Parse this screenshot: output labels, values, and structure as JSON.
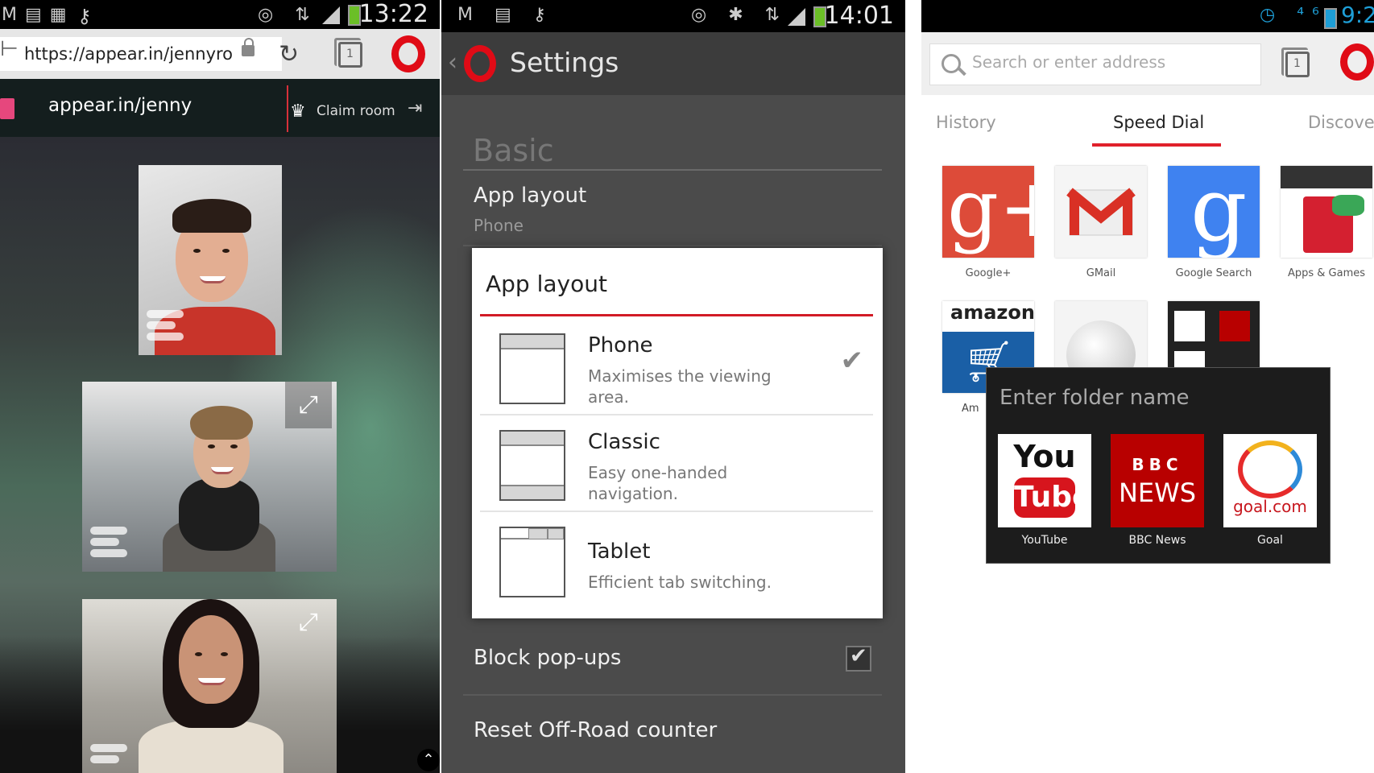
{
  "panel1": {
    "status_time": "13:22",
    "url": "https://appear.in/jennyro",
    "room_name": "appear.in/jenny",
    "claim_room": "Claim room"
  },
  "panel2": {
    "status_time": "14:01",
    "title": "Settings",
    "section": "Basic",
    "app_layout_label": "App layout",
    "app_layout_value": "Phone",
    "dialog": {
      "title": "App layout",
      "options": [
        {
          "name": "Phone",
          "desc": "Maximises the viewing area.",
          "selected": true
        },
        {
          "name": "Classic",
          "desc": "Easy one-handed navigation.",
          "selected": false
        },
        {
          "name": "Tablet",
          "desc": "Efficient tab switching.",
          "selected": false
        }
      ]
    },
    "block_popups": "Block pop-ups",
    "reset_offroad": "Reset Off-Road counter"
  },
  "panel3": {
    "status_time": "9:2",
    "search_placeholder": "Search or enter address",
    "tabs": [
      "History",
      "Speed Dial",
      "Discove"
    ],
    "speed_dials": [
      {
        "label": "Google+",
        "color": "#dd4b39"
      },
      {
        "label": "GMail",
        "color": "#f5f5f5"
      },
      {
        "label": "Google Search",
        "color": "#3f82f0"
      },
      {
        "label": "Apps & Games",
        "color": "#ffffff"
      }
    ],
    "second_row_label": "Am",
    "amazon_text": "amazon",
    "folder": {
      "title": "Enter folder name",
      "items": [
        {
          "label": "YouTube",
          "logo_top": "You",
          "logo_bottom": "Tube"
        },
        {
          "label": "BBC News",
          "logo_top": "BBC",
          "logo_bottom": "NEWS"
        },
        {
          "label": "Goal",
          "logo_top": "goal.com",
          "logo_bottom": ""
        }
      ]
    }
  }
}
